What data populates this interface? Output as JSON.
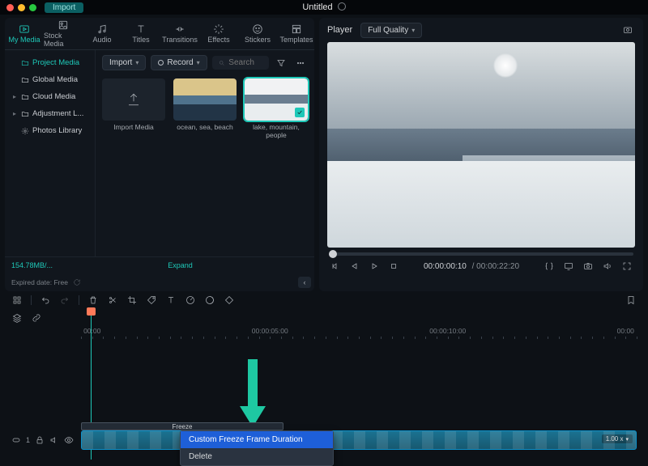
{
  "titlebar": {
    "import_label": "Import",
    "project_title": "Untitled"
  },
  "media_tabs": {
    "my_media": "My Media",
    "stock_media": "Stock Media",
    "audio": "Audio",
    "titles": "Titles",
    "transitions": "Transitions",
    "effects": "Effects",
    "stickers": "Stickers",
    "templates": "Templates"
  },
  "sidebar": {
    "project_media": "Project Media",
    "global_media": "Global Media",
    "cloud_media": "Cloud Media",
    "adjustment": "Adjustment L...",
    "photos_library": "Photos Library"
  },
  "media_toolbar": {
    "import": "Import",
    "record": "Record",
    "search_placeholder": "Search"
  },
  "media_cards": {
    "import_media": "Import Media",
    "clip1": "ocean, sea, beach",
    "clip2": "lake, mountain, people"
  },
  "storage": {
    "used": "154.78MB/...",
    "expand": "Expand",
    "expired": "Expired date: Free"
  },
  "player": {
    "label": "Player",
    "quality": "Full Quality",
    "current_time": "00:00:00:10",
    "total_time": "00:00:22:20"
  },
  "timeline": {
    "t0": "00:00",
    "t1": "00:00:05:00",
    "t2": "00:00:10:00",
    "t3": "00:00",
    "freeze_label": "Freeze",
    "rate": "1.00 x",
    "track_id": "1"
  },
  "context_menu": {
    "custom_duration": "Custom Freeze Frame Duration",
    "delete": "Delete"
  }
}
